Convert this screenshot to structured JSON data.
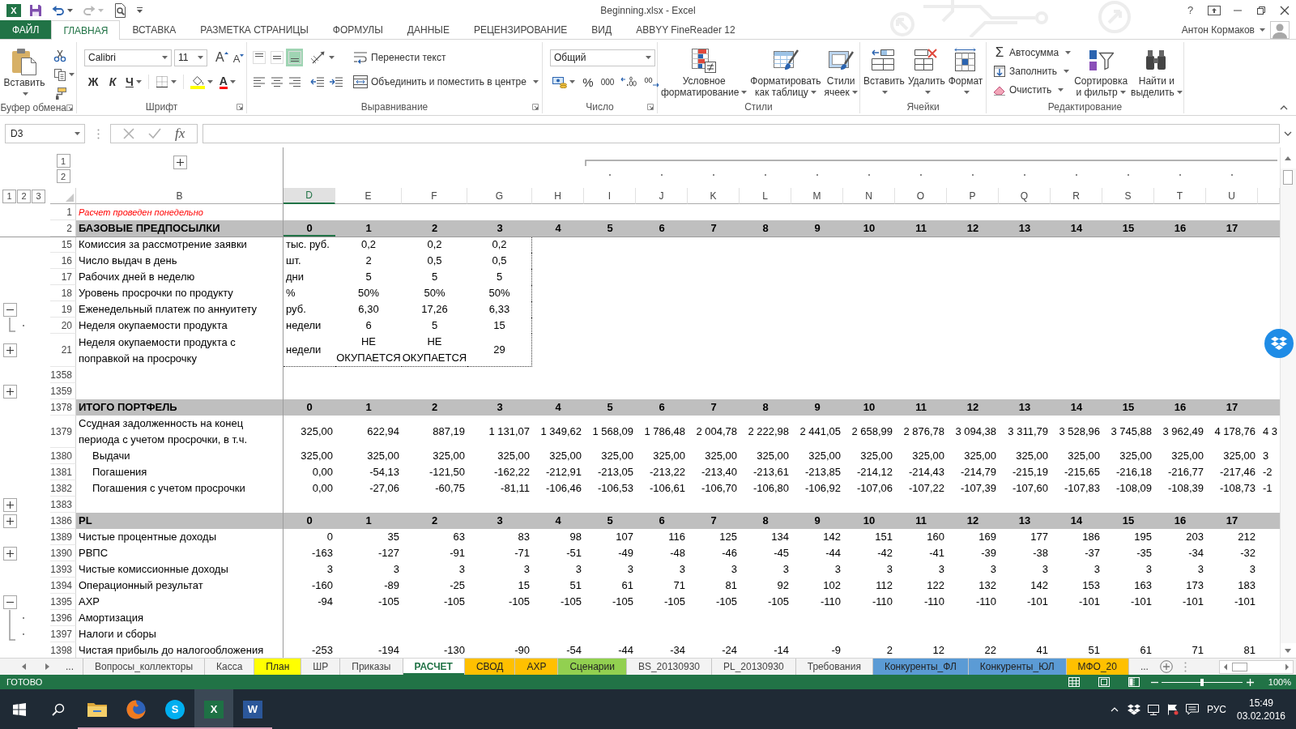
{
  "title_bar": {
    "app_letter": "X",
    "title": "Beginning.xlsx - Excel",
    "help": "?"
  },
  "ribbon": {
    "tabs": [
      {
        "label": "ФАЙЛ",
        "kind": "file",
        "selected": false
      },
      {
        "label": "ГЛАВНАЯ",
        "kind": "tab",
        "selected": true
      },
      {
        "label": "ВСТАВКА",
        "kind": "tab",
        "selected": false
      },
      {
        "label": "РАЗМЕТКА СТРАНИЦЫ",
        "kind": "tab",
        "selected": false
      },
      {
        "label": "ФОРМУЛЫ",
        "kind": "tab",
        "selected": false
      },
      {
        "label": "ДАННЫЕ",
        "kind": "tab",
        "selected": false
      },
      {
        "label": "РЕЦЕНЗИРОВАНИЕ",
        "kind": "tab",
        "selected": false
      },
      {
        "label": "ВИД",
        "kind": "tab",
        "selected": false
      },
      {
        "label": "ABBYY FineReader 12",
        "kind": "tab",
        "selected": false
      }
    ],
    "account": "Антон Кормаков",
    "groups": [
      {
        "kind": "clipboard",
        "title": "Буфер обмена",
        "paste": "Вставить"
      },
      {
        "kind": "font",
        "title": "Шрифт",
        "font": "Calibri",
        "size": "11",
        "grow_glyph": "A",
        "shrink_glyph": "A",
        "bold": "Ж",
        "italic": "К",
        "underline": "Ч",
        "font_color_glyph": "A"
      },
      {
        "kind": "alignment",
        "title": "Выравнивание",
        "vertical": [
          {
            "selected": false
          },
          {
            "selected": false
          },
          {
            "selected": true
          }
        ],
        "wrap": "Перенести текст",
        "merge": "Объединить и поместить в центре"
      },
      {
        "kind": "number",
        "title": "Число",
        "format": "Общий",
        "percent": "%",
        "thousands": "000"
      },
      {
        "kind": "styles",
        "title": "Стили",
        "buttons": [
          {
            "lines": [
              "Условное",
              "форматирование"
            ]
          },
          {
            "lines": [
              "Форматировать",
              "как таблицу"
            ]
          },
          {
            "lines": [
              "Стили",
              "ячеек"
            ]
          }
        ]
      },
      {
        "kind": "cells",
        "title": "Ячейки",
        "buttons": [
          {
            "lines": [
              "Вставить"
            ]
          },
          {
            "lines": [
              "Удалить"
            ]
          },
          {
            "lines": [
              "Формат"
            ]
          }
        ]
      },
      {
        "kind": "editing",
        "title": "Редактирование",
        "autosum_glyph": "Σ",
        "small": [
          "Автосумма",
          "Заполнить",
          "Очистить"
        ],
        "buttons": [
          {
            "lines": [
              "Сортировка",
              "и фильтр"
            ]
          },
          {
            "lines": [
              "Найти и",
              "выделить"
            ]
          }
        ]
      }
    ]
  },
  "formula_bar": {
    "name_box": "D3",
    "insert_function": "fx"
  },
  "sheet": {
    "column_levels": [
      "1",
      "2"
    ],
    "row_levels": [
      "1",
      "2",
      "3"
    ],
    "column_group": {
      "expanded": false
    },
    "columns": [
      {
        "letter": "B",
        "selected": false
      },
      {
        "letter": "D",
        "selected": true
      },
      {
        "letter": "E",
        "selected": false
      },
      {
        "letter": "F",
        "selected": false
      },
      {
        "letter": "G",
        "selected": false
      },
      {
        "letter": "H",
        "selected": false
      },
      {
        "letter": "I",
        "selected": false
      },
      {
        "letter": "J",
        "selected": false
      },
      {
        "letter": "K",
        "selected": false
      },
      {
        "letter": "L",
        "selected": false
      },
      {
        "letter": "M",
        "selected": false
      },
      {
        "letter": "N",
        "selected": false
      },
      {
        "letter": "O",
        "selected": false
      },
      {
        "letter": "P",
        "selected": false
      },
      {
        "letter": "Q",
        "selected": false
      },
      {
        "letter": "R",
        "selected": false
      },
      {
        "letter": "S",
        "selected": false
      },
      {
        "letter": "T",
        "selected": false
      },
      {
        "letter": "U",
        "selected": false
      }
    ],
    "frozen_rows": [
      {
        "number": "1",
        "kind": "note",
        "label": "Расчет проведен понедельно"
      },
      {
        "number": "2",
        "kind": "section",
        "label": "БАЗОВЫЕ ПРЕДПОСЫЛКИ",
        "cells": [
          "0",
          "1",
          "2",
          "3",
          "4",
          "5",
          "6",
          "7",
          "8",
          "9",
          "10",
          "11",
          "12",
          "13",
          "14",
          "15",
          "16",
          "17"
        ]
      }
    ],
    "rows": [
      {
        "number": "15",
        "kind": "param",
        "label": "Комиссия за рассмотрение заявки",
        "unit": "тыс. руб.",
        "cells": [
          "0,2",
          "0,2",
          "0,2"
        ]
      },
      {
        "number": "16",
        "kind": "param",
        "label": "Число выдач в день",
        "unit": "шт.",
        "cells": [
          "2",
          "0,5",
          "0,5"
        ]
      },
      {
        "number": "17",
        "kind": "param",
        "label": "Рабочих дней в неделю",
        "unit": "дни",
        "cells": [
          "5",
          "5",
          "5"
        ]
      },
      {
        "number": "18",
        "kind": "param",
        "label": "Уровень просрочки по продукту",
        "unit": "%",
        "cells": [
          "50%",
          "50%",
          "50%"
        ]
      },
      {
        "number": "19",
        "kind": "param",
        "outline": {
          "kind": "button",
          "expanded": true
        },
        "label": "Еженедельный платеж по аннуитету",
        "unit": "руб.",
        "cells": [
          "6,30",
          "17,26",
          "6,33"
        ]
      },
      {
        "number": "20",
        "kind": "param",
        "outline": {
          "kind": "end"
        },
        "label": "Неделя окупаемости продукта",
        "unit": "недели",
        "cells": [
          "6",
          "5",
          "15"
        ]
      },
      {
        "number": "21",
        "kind": "param",
        "outline": {
          "kind": "button",
          "expanded": false
        },
        "label": "Неделя окупаемости продукта с поправкой на просрочку",
        "unit": "недели",
        "cells": [
          "НЕ ОКУПАЕТСЯ",
          "НЕ ОКУПАЕТСЯ",
          "29"
        ]
      },
      {
        "number": "1358",
        "kind": "blank"
      },
      {
        "number": "1359",
        "kind": "blank",
        "outline": {
          "kind": "button",
          "expanded": false
        }
      },
      {
        "number": "1378",
        "kind": "section",
        "label": "ИТОГО ПОРТФЕЛЬ",
        "cells": [
          "0",
          "1",
          "2",
          "3",
          "4",
          "5",
          "6",
          "7",
          "8",
          "9",
          "10",
          "11",
          "12",
          "13",
          "14",
          "15",
          "16",
          "17"
        ]
      },
      {
        "number": "1379",
        "kind": "amount",
        "label": "Ссудная задолженность на конец периода с учетом просрочки, в т.ч.",
        "cells": [
          "325,00",
          "622,94",
          "887,19",
          "1 131,07",
          "1 349,62",
          "1 568,09",
          "1 786,48",
          "2 004,78",
          "2 222,98",
          "2 441,05",
          "2 658,99",
          "2 876,78",
          "3 094,38",
          "3 311,79",
          "3 528,96",
          "3 745,88",
          "3 962,49",
          "4 178,76"
        ],
        "cut": "4 3"
      },
      {
        "number": "1380",
        "kind": "subamount",
        "label": "Выдачи",
        "cells": [
          "325,00",
          "325,00",
          "325,00",
          "325,00",
          "325,00",
          "325,00",
          "325,00",
          "325,00",
          "325,00",
          "325,00",
          "325,00",
          "325,00",
          "325,00",
          "325,00",
          "325,00",
          "325,00",
          "325,00",
          "325,00"
        ],
        "cut": "3"
      },
      {
        "number": "1381",
        "kind": "subamount",
        "label": "Погашения",
        "cells": [
          "0,00",
          "-54,13",
          "-121,50",
          "-162,22",
          "-212,91",
          "-213,05",
          "-213,22",
          "-213,40",
          "-213,61",
          "-213,85",
          "-214,12",
          "-214,43",
          "-214,79",
          "-215,19",
          "-215,65",
          "-216,18",
          "-216,77",
          "-217,46"
        ],
        "cut": "-2"
      },
      {
        "number": "1382",
        "kind": "subamount",
        "label": "Погашения с учетом просрочки",
        "cells": [
          "0,00",
          "-27,06",
          "-60,75",
          "-81,11",
          "-106,46",
          "-106,53",
          "-106,61",
          "-106,70",
          "-106,80",
          "-106,92",
          "-107,06",
          "-107,22",
          "-107,39",
          "-107,60",
          "-107,83",
          "-108,09",
          "-108,39",
          "-108,73"
        ],
        "cut": "-1"
      },
      {
        "number": "1383",
        "kind": "blank",
        "outline": {
          "kind": "button",
          "expanded": false
        }
      },
      {
        "number": "1386",
        "kind": "section",
        "outline": {
          "kind": "button",
          "expanded": false
        },
        "label": "PL",
        "cells": [
          "0",
          "1",
          "2",
          "3",
          "4",
          "5",
          "6",
          "7",
          "8",
          "9",
          "10",
          "11",
          "12",
          "13",
          "14",
          "15",
          "16",
          "17"
        ]
      },
      {
        "number": "1389",
        "kind": "amount",
        "label": "Чистые процентные доходы",
        "cells": [
          "0",
          "35",
          "63",
          "83",
          "98",
          "107",
          "116",
          "125",
          "134",
          "142",
          "151",
          "160",
          "169",
          "177",
          "186",
          "195",
          "203",
          "212"
        ]
      },
      {
        "number": "1390",
        "kind": "amount",
        "outline": {
          "kind": "button",
          "expanded": false
        },
        "label": "РВПС",
        "cells": [
          "-163",
          "-127",
          "-91",
          "-71",
          "-51",
          "-49",
          "-48",
          "-46",
          "-45",
          "-44",
          "-42",
          "-41",
          "-39",
          "-38",
          "-37",
          "-35",
          "-34",
          "-32"
        ]
      },
      {
        "number": "1393",
        "kind": "amount",
        "label": "Чистые комиссионные доходы",
        "cells": [
          "3",
          "3",
          "3",
          "3",
          "3",
          "3",
          "3",
          "3",
          "3",
          "3",
          "3",
          "3",
          "3",
          "3",
          "3",
          "3",
          "3",
          "3"
        ]
      },
      {
        "number": "1394",
        "kind": "amount",
        "label": "Операционный результат",
        "cells": [
          "-160",
          "-89",
          "-25",
          "15",
          "51",
          "61",
          "71",
          "81",
          "92",
          "102",
          "112",
          "122",
          "132",
          "142",
          "153",
          "163",
          "173",
          "183"
        ]
      },
      {
        "number": "1395",
        "kind": "amount",
        "outline": {
          "kind": "button",
          "expanded": true
        },
        "label": "АХР",
        "cells": [
          "-94",
          "-105",
          "-105",
          "-105",
          "-105",
          "-105",
          "-105",
          "-105",
          "-105",
          "-110",
          "-110",
          "-110",
          "-110",
          "-101",
          "-101",
          "-101",
          "-101",
          "-101"
        ]
      },
      {
        "number": "1396",
        "kind": "amount",
        "outline": {
          "kind": "member"
        },
        "label": "Амортизация"
      },
      {
        "number": "1397",
        "kind": "amount",
        "outline": {
          "kind": "end"
        },
        "label": "Налоги и сборы"
      },
      {
        "number": "1398",
        "kind": "amount",
        "label": "Чистая прибыль до налогообложения",
        "cells": [
          "-253",
          "-194",
          "-130",
          "-90",
          "-54",
          "-44",
          "-34",
          "-24",
          "-14",
          "-9",
          "2",
          "12",
          "22",
          "41",
          "51",
          "61",
          "71",
          "81"
        ]
      }
    ]
  },
  "sheet_tabs": {
    "more_left": "...",
    "tabs": [
      {
        "label": "Вопросы_коллекторы",
        "selected": false
      },
      {
        "label": "Касса",
        "selected": false
      },
      {
        "label": "План",
        "selected": false,
        "color": "#ffff00"
      },
      {
        "label": "ШР",
        "selected": false
      },
      {
        "label": "Приказы",
        "selected": false
      },
      {
        "label": "РАСЧЕТ",
        "selected": true
      },
      {
        "label": "СВОД",
        "selected": false,
        "color": "#ffc000"
      },
      {
        "label": "АХР",
        "selected": false,
        "color": "#ffc000"
      },
      {
        "label": "Сценарии",
        "selected": false,
        "color": "#92d050"
      },
      {
        "label": "BS_20130930",
        "selected": false
      },
      {
        "label": "PL_20130930",
        "selected": false
      },
      {
        "label": "Требования",
        "selected": false
      },
      {
        "label": "Конкуренты_ФЛ",
        "selected": false,
        "color": "#5b9bd5"
      },
      {
        "label": "Конкуренты_ЮЛ",
        "selected": false,
        "color": "#5b9bd5"
      },
      {
        "label": "МФО_20",
        "selected": false,
        "color": "#ffc000"
      }
    ],
    "more_right": "..."
  },
  "status_bar": {
    "status": "ГОТОВО",
    "zoom_slider": {
      "level": 0.5
    },
    "zoom": "100%"
  },
  "taskbar": {
    "apps": [
      {
        "kind": "explorer",
        "active": false,
        "running": true
      },
      {
        "kind": "browser",
        "active": false,
        "running": true
      },
      {
        "kind": "messenger",
        "letter": "S",
        "active": false,
        "running": true
      },
      {
        "kind": "spreadsheet",
        "letter": "X",
        "active": true,
        "running": true
      },
      {
        "kind": "document",
        "letter": "W",
        "active": false,
        "running": true
      }
    ],
    "language": "РУС",
    "time": "15:49",
    "date": "03.02.2016"
  }
}
